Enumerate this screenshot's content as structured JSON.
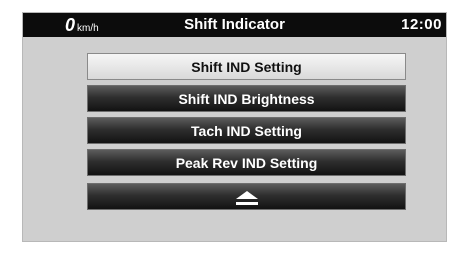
{
  "status_bar": {
    "speed_value": "0",
    "speed_unit": "km/h",
    "title": "Shift Indicator",
    "clock": "12:00"
  },
  "menu": {
    "items": [
      {
        "label": "Shift IND Setting",
        "selected": true
      },
      {
        "label": "Shift IND Brightness",
        "selected": false
      },
      {
        "label": "Tach IND Setting",
        "selected": false
      },
      {
        "label": "Peak Rev IND Setting",
        "selected": false
      }
    ],
    "scroll_up_icon": "eject-up-arrow-icon"
  },
  "colors": {
    "status_bar_bg": "#0c0c0c",
    "screen_bg": "#cfcfcf",
    "selected_button": "#e6e6e6",
    "dark_button": "#2f2f2f"
  }
}
